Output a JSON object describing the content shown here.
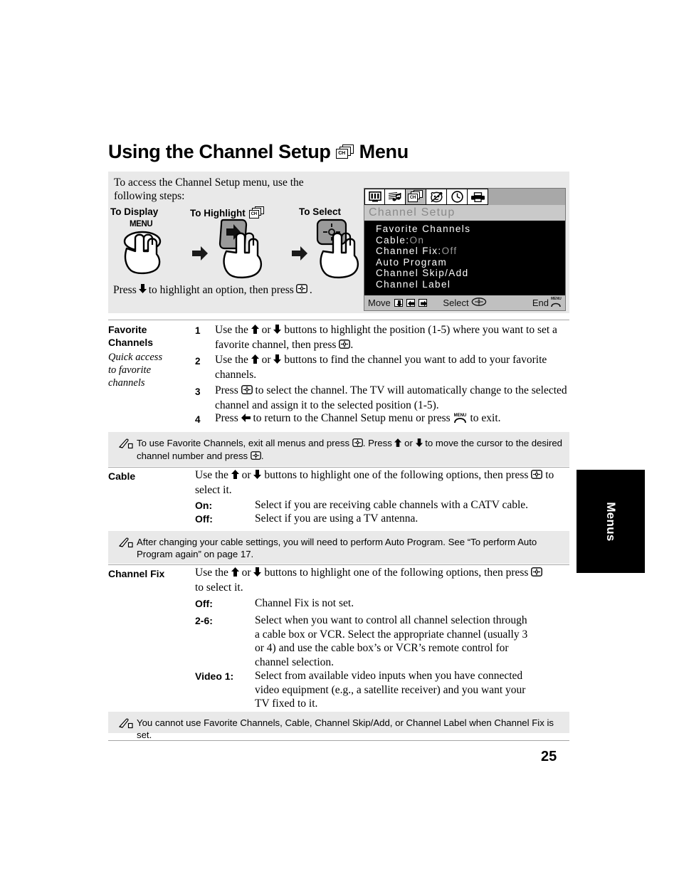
{
  "title": {
    "before": "Using the Channel Setup",
    "icon": "channel-setup-icon",
    "icon_label": "CH",
    "after": "Menu"
  },
  "intro": {
    "line1": "To access the Channel Setup menu, use the",
    "line2": "following steps:"
  },
  "steps_headers": {
    "display": "To Display",
    "highlight": "To Highlight",
    "highlight_icon_label": "CH",
    "select": "To Select"
  },
  "steps_buttons": {
    "menu": "MENU"
  },
  "press_line": {
    "a": "Press",
    "b": "to highlight an option, then press",
    "c": "."
  },
  "tv_menu": {
    "icons": [
      "video-icon",
      "audio-icon",
      "channel-icon",
      "parental-icon",
      "timer-icon",
      "setup-icon"
    ],
    "selected_icon_index": 2,
    "channel_icon_label": "CH",
    "title": "Channel Setup",
    "items": [
      {
        "label": "Favorite Channels",
        "value": ""
      },
      {
        "label": "Cable:",
        "value": "On"
      },
      {
        "label": "Channel Fix:",
        "value": "Off"
      },
      {
        "label": "Auto Program",
        "value": ""
      },
      {
        "label": "Channel Skip/Add",
        "value": ""
      },
      {
        "label": "Channel Label",
        "value": ""
      }
    ],
    "footer": {
      "move": "Move",
      "select": "Select",
      "end": "End",
      "end_icon_label": "MENU"
    }
  },
  "favorite_channels": {
    "label_line1": "Favorite",
    "label_line2": "Channels",
    "sub_line1": "Quick access",
    "sub_line2": "to favorite",
    "sub_line3": "channels",
    "steps": [
      {
        "n": "1",
        "l1a": "Use the",
        "l1b": "or",
        "l1c": "buttons to highlight the position (1-5) where you want",
        "l2a": "to set a favorite channel, then press",
        "l2b": "."
      },
      {
        "n": "2",
        "l1a": "Use the",
        "l1b": "or",
        "l1c": "buttons to find the channel you want to add to your",
        "l2a": "favorite channels.",
        "l2b": ""
      },
      {
        "n": "3",
        "l1a": "Press",
        "l1b": "",
        "l1c": "to select the channel. The TV will automatically change to the",
        "l2a": "selected channel and assign it to the selected position (1-5).",
        "l2b": ""
      },
      {
        "n": "4",
        "l1a": "Press",
        "l1b": "",
        "l1c": "to return to the Channel Setup menu or press",
        "l2a": "",
        "l2b": "to exit."
      }
    ]
  },
  "note1": {
    "a": "To use Favorite Channels, exit all menus and press",
    "b": ". Press",
    "c": "or",
    "d": "to move the cursor to the",
    "e": "desired channel number and press",
    "f": "."
  },
  "cable": {
    "label": "Cable",
    "intro_a": "Use the",
    "intro_b": "or",
    "intro_c": "buttons to highlight one of the following options, then press",
    "intro_d": "to select it.",
    "options": [
      {
        "key": "On:",
        "desc": "Select if you are receiving cable channels with a CATV cable."
      },
      {
        "key": "Off:",
        "desc": "Select if you are using a TV antenna."
      }
    ]
  },
  "note2": {
    "line1": "After changing your cable settings, you will need to perform Auto Program. See “To perform Auto",
    "line2": "Program again” on page 17."
  },
  "channel_fix": {
    "label": "Channel Fix",
    "intro_a": "Use the",
    "intro_b": "or",
    "intro_c": "buttons to highlight one of the following options, then",
    "intro_d": "press",
    "intro_e": "to select it.",
    "options": [
      {
        "key": "Off:",
        "lines": [
          "Channel Fix is not set."
        ]
      },
      {
        "key": "2-6:",
        "lines": [
          "Select when you want to control all channel selection through",
          "a cable box or VCR. Select the appropriate channel (usually 3",
          "or 4) and use the cable box’s or VCR’s remote control for",
          "channel selection."
        ]
      },
      {
        "key": "Video 1:",
        "lines": [
          "Select from available video inputs when you have connected",
          "video equipment (e.g., a satellite receiver) and you want your",
          "TV fixed to it."
        ]
      }
    ]
  },
  "note3": {
    "text": "You cannot use Favorite Channels, Cable, Channel Skip/Add, or Channel Label when Channel Fix is set."
  },
  "side_tab": {
    "label": "Menus"
  },
  "page_number": "25"
}
